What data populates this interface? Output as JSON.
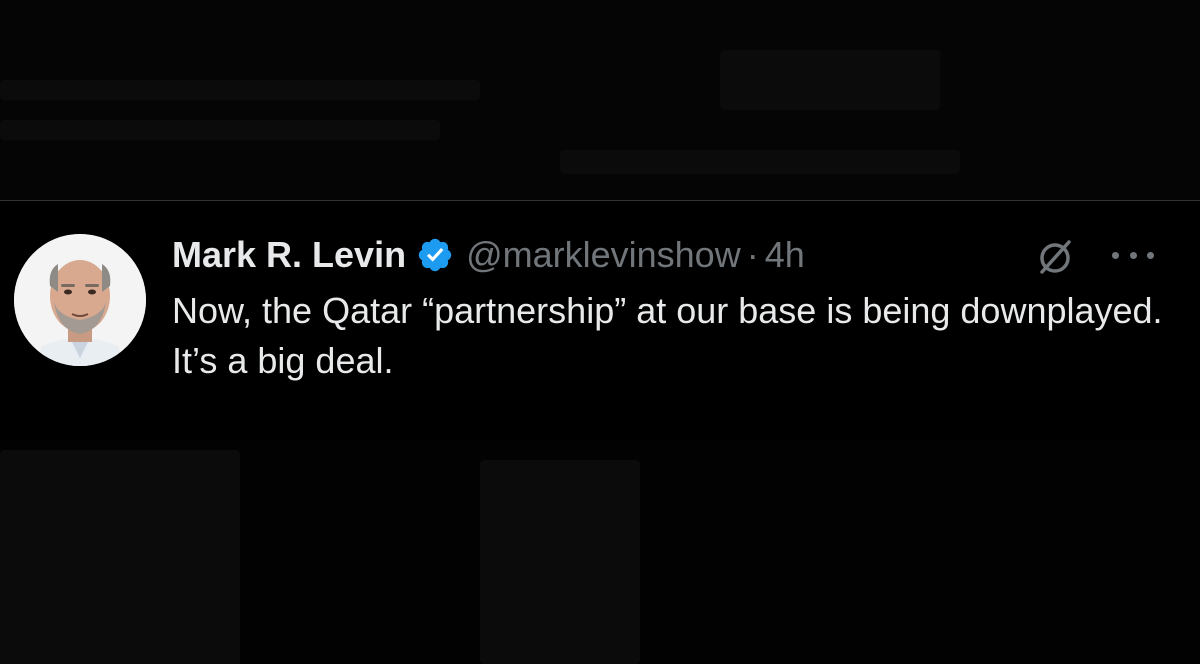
{
  "tweet": {
    "author_name": "Mark R. Levin",
    "handle": "@marklevinshow",
    "separator": "·",
    "time": "4h",
    "text": "Now, the Qatar “partnership” at our base is being downplayed. It’s a big deal."
  },
  "icons": {
    "verified": "verified-badge-icon",
    "grok": "grok-icon",
    "more": "more-options-icon"
  },
  "colors": {
    "background": "#000000",
    "text_primary": "#e7e9ea",
    "text_secondary": "#71767b",
    "verified": "#1d9bf0",
    "divider": "#2f3336"
  }
}
